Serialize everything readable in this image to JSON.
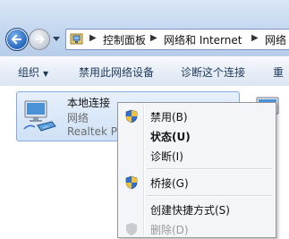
{
  "address_bar": {
    "crumbs": [
      "控制面板",
      "网络和 Internet",
      "网络"
    ],
    "icons": {
      "location": "network-folder-icon",
      "back": "back-arrow-icon",
      "forward": "forward-arrow-icon"
    }
  },
  "command_bar": {
    "organize": "组织",
    "disable_device": "禁用此网络设备",
    "diagnose": "诊断这个连接",
    "rename": "重"
  },
  "adapter": {
    "name": "本地连接",
    "type": "网络",
    "device": "Realtek PC"
  },
  "context_menu": {
    "items": [
      {
        "label": "禁用(B)",
        "shield": true,
        "bold": false,
        "disabled": false
      },
      {
        "label": "状态(U)",
        "shield": false,
        "bold": true,
        "disabled": false
      },
      {
        "label": "诊断(I)",
        "shield": false,
        "bold": false,
        "disabled": false
      },
      {
        "label": "桥接(G)",
        "shield": true,
        "bold": false,
        "disabled": false
      },
      {
        "label": "创建快捷方式(S)",
        "shield": false,
        "bold": false,
        "disabled": false
      },
      {
        "label": "删除(D)",
        "shield": true,
        "bold": false,
        "disabled": true
      }
    ]
  },
  "colors": {
    "shield_blue": "#2f6fd6",
    "shield_yellow": "#f2c12e",
    "selection_bg": "#cfe1f6"
  }
}
